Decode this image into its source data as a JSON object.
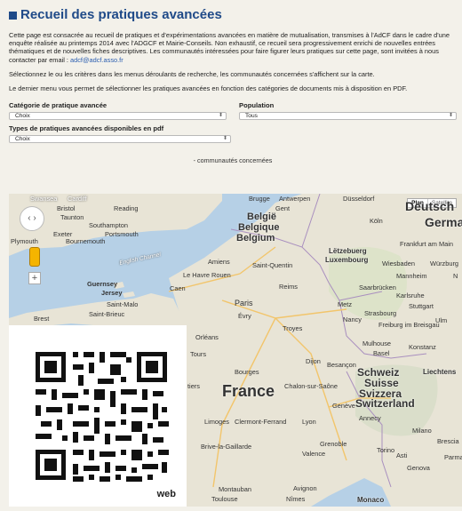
{
  "header": {
    "title": "Recueil des pratiques avancées"
  },
  "intro": {
    "paragraph1": "Cette page est consacrée au recueil de pratiques et d'expérimentations avancées en matière de mutualisation, transmises à l'AdCF dans le cadre d'une enquête réalisée au printemps 2014 avec l'ADGCF et Mairie-Conseils. Non exhaustif, ce recueil sera progressivement enrichi de nouvelles entrées thématiques et de nouvelles fiches descriptives. Les communautés intéressées pour faire figurer leurs pratiques sur cette page, sont invitées à nous contacter par email : ",
    "email": "adcf@adcf.asso.fr",
    "paragraph2": "Sélectionnez le ou les critères dans les menus déroulants de recherche, les communautés concernées s'affichent sur la carte.",
    "paragraph3": "Le dernier menu vous permet de sélectionner les pratiques avancées en fonction des catégories de documents mis à disposition en PDF."
  },
  "filters": {
    "category_label": "Catégorie de pratique avancée",
    "category_value": "Choix",
    "population_label": "Population",
    "population_value": "Tous",
    "types_label": "Types de pratiques avancées disponibles en pdf",
    "types_value": "Choix"
  },
  "results": {
    "count_text": "- communautés concernées"
  },
  "map": {
    "type_plan": "Plan",
    "type_satellite": "Satellite",
    "countries": {
      "belgium_nl": "België",
      "belgium_fr": "Belgique",
      "belgium_en": "Belgium",
      "france": "France",
      "swiss_de": "Schweiz",
      "swiss_fr": "Suisse",
      "swiss_it": "Svizzera",
      "swiss_en": "Switzerland",
      "germany_1": "Deutsch",
      "germany_2": "Germa",
      "lux_1": "Lëtzebuerg",
      "lux_2": "Luxembourg",
      "monaco": "Monaco",
      "liechtenstein": "Liechtens"
    },
    "cities": {
      "swansea": "Swansea",
      "cardiff": "Cardiff",
      "bristol": "Bristol",
      "reading": "Reading",
      "taunton": "Taunton",
      "southampton": "Southampton",
      "exeter": "Exeter",
      "portsmouth": "Portsmouth",
      "plymouth": "Plymouth",
      "bournemouth": "Bournemouth",
      "english_channel": "English Channel",
      "guernsey": "Guernsey",
      "jersey": "Jersey",
      "le_havre": "Le Havre",
      "rouen": "Rouen",
      "caen": "Caen",
      "saint_malo": "Saint-Malo",
      "saint_brieuc": "Saint-Brieuc",
      "brest": "Brest",
      "orleans": "Orléans",
      "tours": "Tours",
      "bourges": "Bourges",
      "poitiers": "tiers",
      "limoges": "Limoges",
      "clermont": "Clermont-Ferrand",
      "lyon": "Lyon",
      "brive": "Brive-la-Gaillarde",
      "montauban": "Montauban",
      "toulouse": "Toulouse",
      "nimes": "Nîmes",
      "avignon": "Avignon",
      "valence": "Valence",
      "grenoble": "Grenoble",
      "annecy": "Annecy",
      "geneve": "Genève",
      "chalon": "Chalon-sur-Saône",
      "dijon": "Dijon",
      "besancon": "Besançon",
      "basel": "Basel",
      "freiburg": "Freiburg im Breisgau",
      "konstanz": "Konstanz",
      "mulhouse": "Mulhouse",
      "nancy": "Nancy",
      "metz": "Metz",
      "strasbourg": "Strasbourg",
      "saarbrucken": "Saarbrücken",
      "karlsruhe": "Karlsruhe",
      "stuttgart": "Stuttgart",
      "ulm": "Ulm",
      "mannheim": "Mannheim",
      "wurzburg": "Würzburg",
      "wiesbaden": "Wiesbaden",
      "frankfurt": "Frankfurt am Main",
      "koln": "Köln",
      "dusseldorf": "Düsseldorf",
      "antwerpen": "Antwerpen",
      "gent": "Gent",
      "brugge": "Brugge",
      "amiens": "Amiens",
      "saint_quentin": "Saint-Quentin",
      "reims": "Reims",
      "paris": "Paris",
      "evry": "Évry",
      "troyes": "Troyes",
      "torino": "Torino",
      "milano": "Milano",
      "brescia": "Brescia",
      "genova": "Genova",
      "asti": "Asti",
      "parma": "Parma",
      "n_label": "N"
    }
  },
  "qr": {
    "caption": "web"
  }
}
